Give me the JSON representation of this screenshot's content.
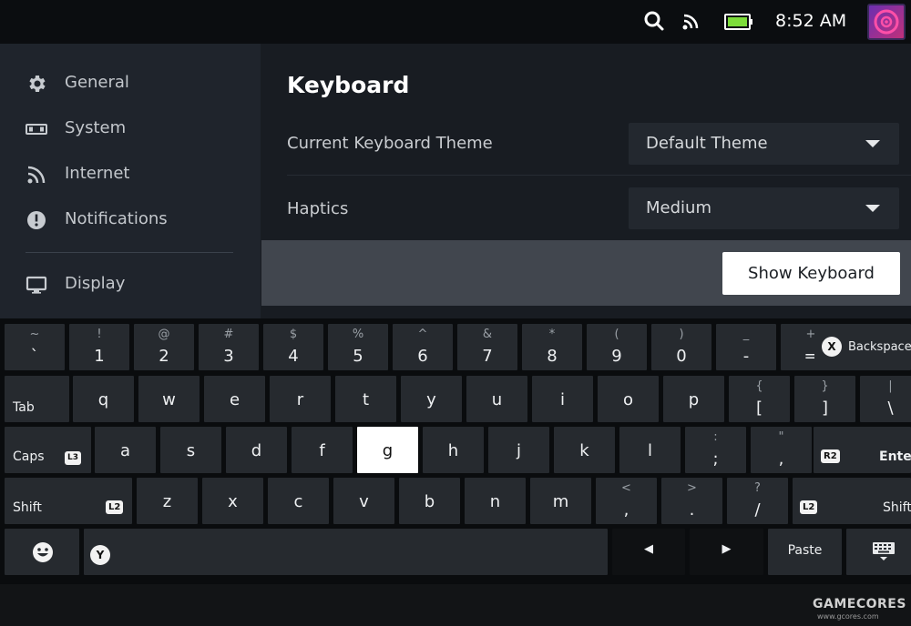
{
  "status_bar": {
    "time": "8:52 AM",
    "icons": [
      "search-icon",
      "rss-icon",
      "battery-icon"
    ]
  },
  "sidebar": {
    "items": [
      {
        "label": "General",
        "icon": "gear-icon"
      },
      {
        "label": "System",
        "icon": "system-icon"
      },
      {
        "label": "Internet",
        "icon": "wifi-icon"
      },
      {
        "label": "Notifications",
        "icon": "alert-icon"
      },
      {
        "label": "Display",
        "icon": "monitor-icon"
      }
    ]
  },
  "main": {
    "title": "Keyboard",
    "theme_label": "Current Keyboard Theme",
    "theme_value": "Default Theme",
    "haptics_label": "Haptics",
    "haptics_value": "Medium",
    "show_keyboard_label": "Show Keyboard"
  },
  "keyboard": {
    "row1": [
      {
        "main": "`",
        "sub": "~"
      },
      {
        "main": "1",
        "sub": "!"
      },
      {
        "main": "2",
        "sub": "@"
      },
      {
        "main": "3",
        "sub": "#"
      },
      {
        "main": "4",
        "sub": "$"
      },
      {
        "main": "5",
        "sub": "%"
      },
      {
        "main": "6",
        "sub": "^"
      },
      {
        "main": "7",
        "sub": "&"
      },
      {
        "main": "8",
        "sub": "*"
      },
      {
        "main": "9",
        "sub": "("
      },
      {
        "main": "0",
        "sub": ")"
      },
      {
        "main": "-",
        "sub": "_"
      },
      {
        "main": "=",
        "sub": "+"
      }
    ],
    "backspace_label": "Backspace",
    "backspace_button": "X",
    "tab_label": "Tab",
    "row2": [
      {
        "main": "q",
        "sub": ""
      },
      {
        "main": "w",
        "sub": ""
      },
      {
        "main": "e",
        "sub": ""
      },
      {
        "main": "r",
        "sub": ""
      },
      {
        "main": "t",
        "sub": ""
      },
      {
        "main": "y",
        "sub": ""
      },
      {
        "main": "u",
        "sub": ""
      },
      {
        "main": "i",
        "sub": ""
      },
      {
        "main": "o",
        "sub": ""
      },
      {
        "main": "p",
        "sub": ""
      },
      {
        "main": "[",
        "sub": "{"
      },
      {
        "main": "]",
        "sub": "}"
      },
      {
        "main": "\\",
        "sub": "|"
      }
    ],
    "caps_label": "Caps",
    "caps_badge": "L3",
    "row3": [
      {
        "main": "a",
        "sub": ""
      },
      {
        "main": "s",
        "sub": ""
      },
      {
        "main": "d",
        "sub": ""
      },
      {
        "main": "f",
        "sub": ""
      },
      {
        "main": "g",
        "sub": ""
      },
      {
        "main": "h",
        "sub": ""
      },
      {
        "main": "j",
        "sub": ""
      },
      {
        "main": "k",
        "sub": ""
      },
      {
        "main": "l",
        "sub": ""
      },
      {
        "main": ";",
        "sub": ":"
      },
      {
        "main": ",",
        "sub": "\""
      }
    ],
    "enter_label": "Enter",
    "enter_badge": "R2",
    "shift_label": "Shift",
    "shift_badge": "L2",
    "row4": [
      {
        "main": "z",
        "sub": ""
      },
      {
        "main": "x",
        "sub": ""
      },
      {
        "main": "c",
        "sub": ""
      },
      {
        "main": "v",
        "sub": ""
      },
      {
        "main": "b",
        "sub": ""
      },
      {
        "main": "n",
        "sub": ""
      },
      {
        "main": "m",
        "sub": ""
      },
      {
        "main": ",",
        "sub": "<"
      },
      {
        "main": ".",
        "sub": ">"
      },
      {
        "main": "/",
        "sub": "?"
      }
    ],
    "shift_right_label": "Shift",
    "shift_right_badge": "L2",
    "space_badge": "Y",
    "left_arrow": "◀",
    "right_arrow": "▶",
    "paste_label": "Paste",
    "active_key": "g"
  },
  "watermark": {
    "title": "GAMECORES",
    "url": "www.gcores.com"
  }
}
